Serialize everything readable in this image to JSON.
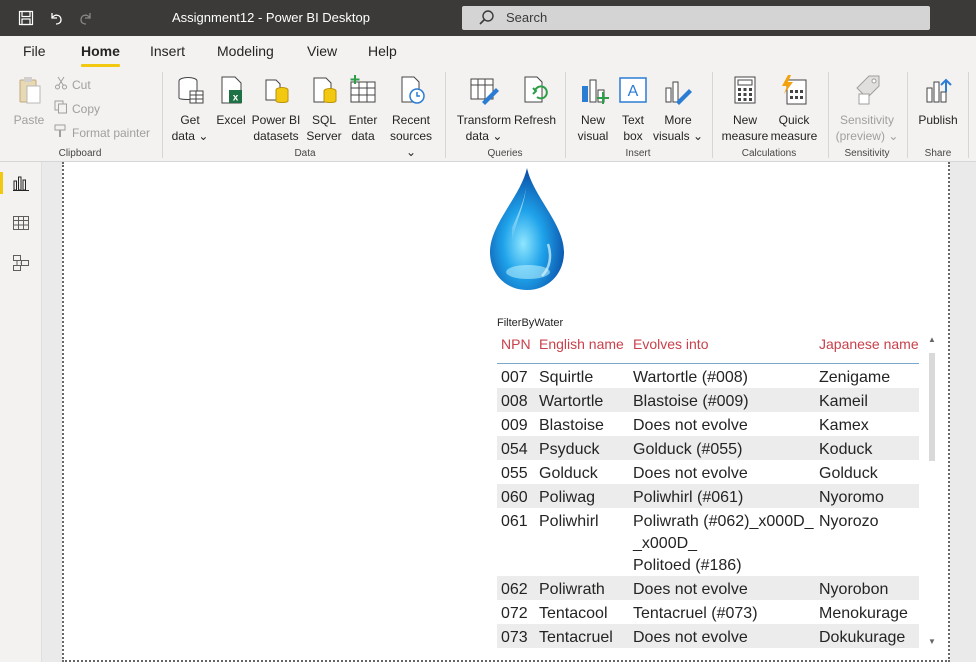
{
  "window": {
    "title": "Assignment12 - Power BI Desktop"
  },
  "search": {
    "placeholder": "Search"
  },
  "menu": {
    "items": [
      "File",
      "Home",
      "Insert",
      "Modeling",
      "View",
      "Help"
    ],
    "active": "Home"
  },
  "clipboard": {
    "paste": "Paste",
    "cut": "Cut",
    "copy": "Copy",
    "format_painter": "Format painter",
    "label": "Clipboard"
  },
  "data_group": {
    "get_data": [
      "Get",
      "data"
    ],
    "excel": "Excel",
    "pbi_datasets": [
      "Power BI",
      "datasets"
    ],
    "sql_server": [
      "SQL",
      "Server"
    ],
    "enter_data": [
      "Enter",
      "data"
    ],
    "recent_sources": [
      "Recent",
      "sources"
    ],
    "label": "Data"
  },
  "queries": {
    "transform": [
      "Transform",
      "data"
    ],
    "refresh": "Refresh",
    "label": "Queries"
  },
  "insert": {
    "new_visual": [
      "New",
      "visual"
    ],
    "text_box": [
      "Text",
      "box"
    ],
    "more_visuals": [
      "More",
      "visuals"
    ],
    "label": "Insert"
  },
  "calculations": {
    "new_measure": [
      "New",
      "measure"
    ],
    "quick_measure": [
      "Quick",
      "measure"
    ],
    "label": "Calculations"
  },
  "sensitivity": {
    "button": [
      "Sensitivity",
      "(preview)"
    ],
    "label": "Sensitivity"
  },
  "share": {
    "publish": "Publish",
    "label": "Share"
  },
  "visual": {
    "title": "FilterByWater",
    "columns": [
      "NPN",
      "English name",
      "Evolves into",
      "Japanese name"
    ],
    "rows": [
      {
        "npn": "007",
        "english": "Squirtle",
        "evolves": [
          "Wartortle (#008)"
        ],
        "japanese": "Zenigame"
      },
      {
        "npn": "008",
        "english": "Wartortle",
        "evolves": [
          "Blastoise (#009)"
        ],
        "japanese": "Kameil"
      },
      {
        "npn": "009",
        "english": "Blastoise",
        "evolves": [
          "Does not evolve"
        ],
        "japanese": "Kamex"
      },
      {
        "npn": "054",
        "english": "Psyduck",
        "evolves": [
          "Golduck (#055)"
        ],
        "japanese": "Koduck"
      },
      {
        "npn": "055",
        "english": "Golduck",
        "evolves": [
          "Does not evolve"
        ],
        "japanese": "Golduck"
      },
      {
        "npn": "060",
        "english": "Poliwag",
        "evolves": [
          "Poliwhirl (#061)"
        ],
        "japanese": "Nyoromo"
      },
      {
        "npn": "061",
        "english": "Poliwhirl",
        "evolves": [
          "Poliwrath (#062)_x000D_",
          "_x000D_",
          "Politoed (#186)"
        ],
        "japanese": "Nyorozo"
      },
      {
        "npn": "062",
        "english": "Poliwrath",
        "evolves": [
          "Does not evolve"
        ],
        "japanese": "Nyorobon"
      },
      {
        "npn": "072",
        "english": "Tentacool",
        "evolves": [
          "Tentacruel (#073)"
        ],
        "japanese": "Menokurage"
      },
      {
        "npn": "073",
        "english": "Tentacruel",
        "evolves": [
          "Does not evolve"
        ],
        "japanese": "Dokukurage"
      }
    ]
  }
}
